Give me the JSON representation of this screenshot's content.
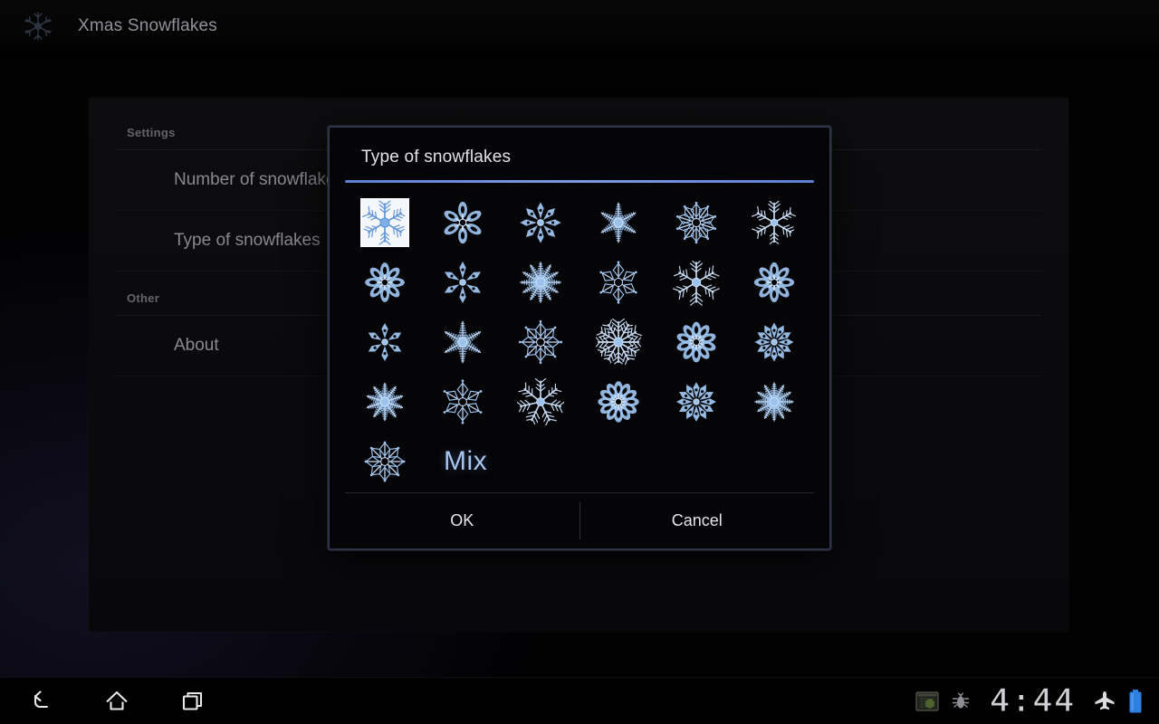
{
  "actionbar": {
    "icon": "snowflake-icon",
    "title": "Xmas Snowflakes"
  },
  "settings": {
    "sections": [
      {
        "header": "Settings",
        "items": [
          {
            "label": "Number of snowflakes"
          },
          {
            "label": "Type of snowflakes"
          }
        ]
      },
      {
        "header": "Other",
        "items": [
          {
            "label": "About"
          }
        ]
      }
    ]
  },
  "dialog": {
    "title": "Type of snowflakes",
    "accent_color": "#7e9ae4",
    "border_color": "#2e3348",
    "selected_index": 0,
    "items": [
      {
        "index": 0,
        "name": "snowflake-classic-dendrite",
        "selected": true
      },
      {
        "index": 1,
        "name": "snowflake-thin-star",
        "selected": false
      },
      {
        "index": 2,
        "name": "snowflake-ring-loop",
        "selected": false
      },
      {
        "index": 3,
        "name": "snowflake-fuzzy-bloom",
        "selected": false
      },
      {
        "index": 4,
        "name": "snowflake-ten-point-star",
        "selected": false
      },
      {
        "index": 5,
        "name": "snowflake-bold-six-arm",
        "selected": false
      },
      {
        "index": 6,
        "name": "snowflake-petal-ring",
        "selected": false
      },
      {
        "index": 7,
        "name": "snowflake-dotted-ring",
        "selected": false
      },
      {
        "index": 8,
        "name": "snowflake-sunburst",
        "selected": false
      },
      {
        "index": 9,
        "name": "snowflake-skeletal-needle",
        "selected": false
      },
      {
        "index": 10,
        "name": "snowflake-spiky-crystal",
        "selected": false
      },
      {
        "index": 11,
        "name": "snowflake-lace-rosette",
        "selected": false
      },
      {
        "index": 12,
        "name": "snowflake-leafy-fern",
        "selected": false
      },
      {
        "index": 13,
        "name": "snowflake-burst-plume",
        "selected": false
      },
      {
        "index": 14,
        "name": "snowflake-geometric-web",
        "selected": false
      },
      {
        "index": 15,
        "name": "snowflake-radial-spokes",
        "selected": false
      },
      {
        "index": 16,
        "name": "snowflake-tangled-mesh",
        "selected": false
      },
      {
        "index": 17,
        "name": "snowflake-dense-lace",
        "selected": false
      },
      {
        "index": 18,
        "name": "snowflake-scalloped-medallion",
        "selected": false
      },
      {
        "index": 19,
        "name": "snowflake-chunky-six-arm",
        "selected": false
      },
      {
        "index": 20,
        "name": "snowflake-seven-point-star",
        "selected": false
      },
      {
        "index": 21,
        "name": "snowflake-bubble-ring",
        "selected": false
      },
      {
        "index": 22,
        "name": "snowflake-twelve-point",
        "selected": false
      },
      {
        "index": 23,
        "name": "snowflake-dotted-disc",
        "selected": false
      },
      {
        "index": 24,
        "name": "snowflake-spoke-halo",
        "selected": false
      }
    ],
    "mix_label": "Mix",
    "ok_label": "OK",
    "cancel_label": "Cancel"
  },
  "systembar": {
    "back_icon": "back-arrow-icon",
    "home_icon": "home-icon",
    "recents_icon": "recent-apps-icon",
    "status_icons": [
      "screenshot-icon",
      "usb-debug-icon",
      "airplane-mode-icon",
      "battery-icon"
    ],
    "clock": "4:44",
    "battery_color": "#2f7fe0"
  }
}
